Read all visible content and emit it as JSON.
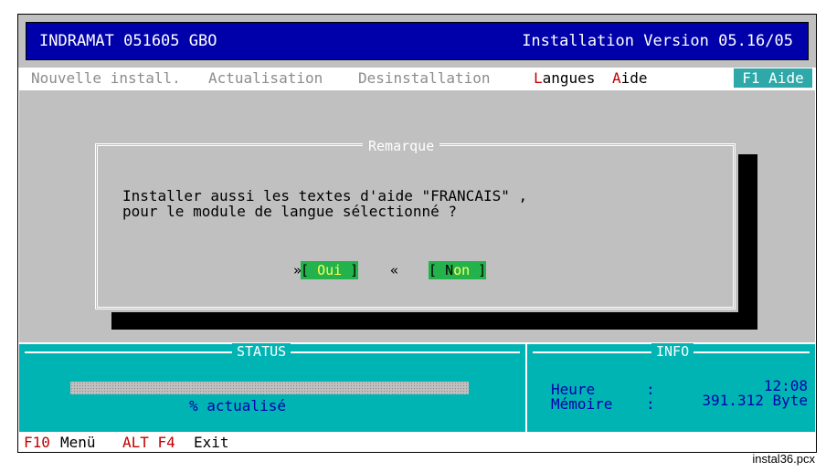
{
  "titlebar": {
    "left": "INDRAMAT 051605 GBO",
    "right": "Installation Version 05.16/05"
  },
  "menu": {
    "items": [
      {
        "label": "Nouvelle install.",
        "state": "disabled"
      },
      {
        "label": "Actualisation",
        "state": "disabled"
      },
      {
        "label": "Desinstallation",
        "state": "disabled"
      },
      {
        "hot": "L",
        "rest": "angues",
        "state": "enabled"
      },
      {
        "hot": "A",
        "rest": "ide",
        "state": "enabled"
      }
    ],
    "help_key": "F1 Aide"
  },
  "dialog": {
    "title": "Remarque",
    "message_line1": "Installer aussi les textes d'aide \"FRANCAIS\" ,",
    "message_line2": "pour le module de langue sélectionné ?",
    "yes_open": "[ ",
    "yes_label": "Oui",
    "yes_close": " ]",
    "no_open": "[ ",
    "no_hot": "N",
    "no_rest": "on",
    "no_close": " ]",
    "focus_left": "»",
    "focus_right": "«"
  },
  "status": {
    "title": "STATUS",
    "progress_fraction": 0,
    "progress_text": "% actualisé"
  },
  "info": {
    "title": "INFO",
    "rows": [
      {
        "key": "Heure",
        "sep": ":",
        "value": "12:08"
      },
      {
        "key": "Mémoire",
        "sep": ":",
        "value": "391.312 Byte"
      }
    ]
  },
  "footer": {
    "k1": "F10",
    "v1": "Menü",
    "k2": "ALT F4",
    "v2": "Exit"
  },
  "caption": "instal36.pcx",
  "colors": {
    "titlebar": "#0000aa",
    "hotkey": "#c00000",
    "panel": "#00b4b4",
    "button": "#24b24c",
    "help": "#2ea8a8"
  }
}
